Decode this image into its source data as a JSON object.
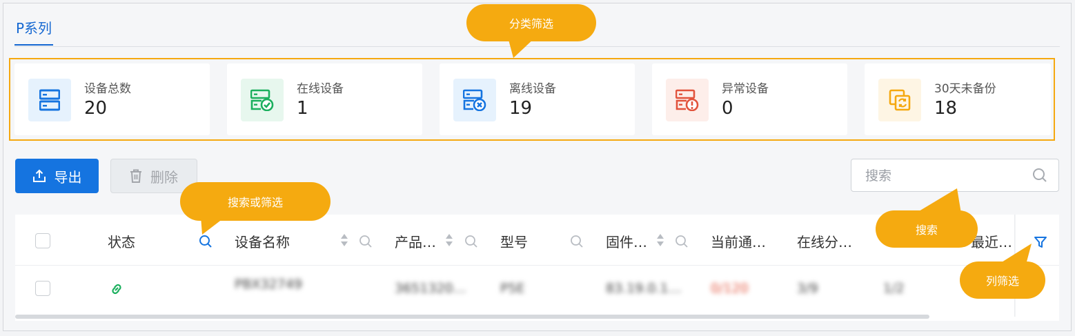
{
  "tabs": {
    "active": "P系列"
  },
  "stats": [
    {
      "label": "设备总数",
      "value": "20",
      "icon": "server-icon",
      "color": "#1574e0",
      "bg": "#e6f2fd"
    },
    {
      "label": "在线设备",
      "value": "1",
      "icon": "server-check-icon",
      "color": "#1aaf5d",
      "bg": "#e7f7ee"
    },
    {
      "label": "离线设备",
      "value": "19",
      "icon": "server-x-icon",
      "color": "#1574e0",
      "bg": "#e6f2fd"
    },
    {
      "label": "异常设备",
      "value": "0",
      "icon": "server-alert-icon",
      "color": "#e2533c",
      "bg": "#fdeeea"
    },
    {
      "label": "30天未备份",
      "value": "18",
      "icon": "backup-sync-icon",
      "color": "#f5a80f",
      "bg": "#fef5e4"
    }
  ],
  "toolbar": {
    "export_label": "导出",
    "delete_label": "删除"
  },
  "search": {
    "placeholder": "搜索"
  },
  "table": {
    "headers": {
      "status": "状态",
      "name": "设备名称",
      "product": "产品…",
      "model": "型号",
      "firmware": "固件…",
      "channels": "当前通…",
      "online": "在线分…",
      "recent": "最近…"
    },
    "row": {
      "name": "PBX32749",
      "product": "3651320…",
      "model": "P5E",
      "firmware": "83.19.0.1…",
      "channels": "0/120",
      "online": "3/9",
      "extra": "1/2"
    }
  },
  "callouts": {
    "category": "分类筛选",
    "search_filter": "搜索或筛选",
    "search": "搜索",
    "column_filter": "列筛选"
  },
  "colors": {
    "accent": "#1574e0",
    "callout": "#f5aa10",
    "online": "#1aaf5d",
    "blurred_red": "#e2533c"
  }
}
